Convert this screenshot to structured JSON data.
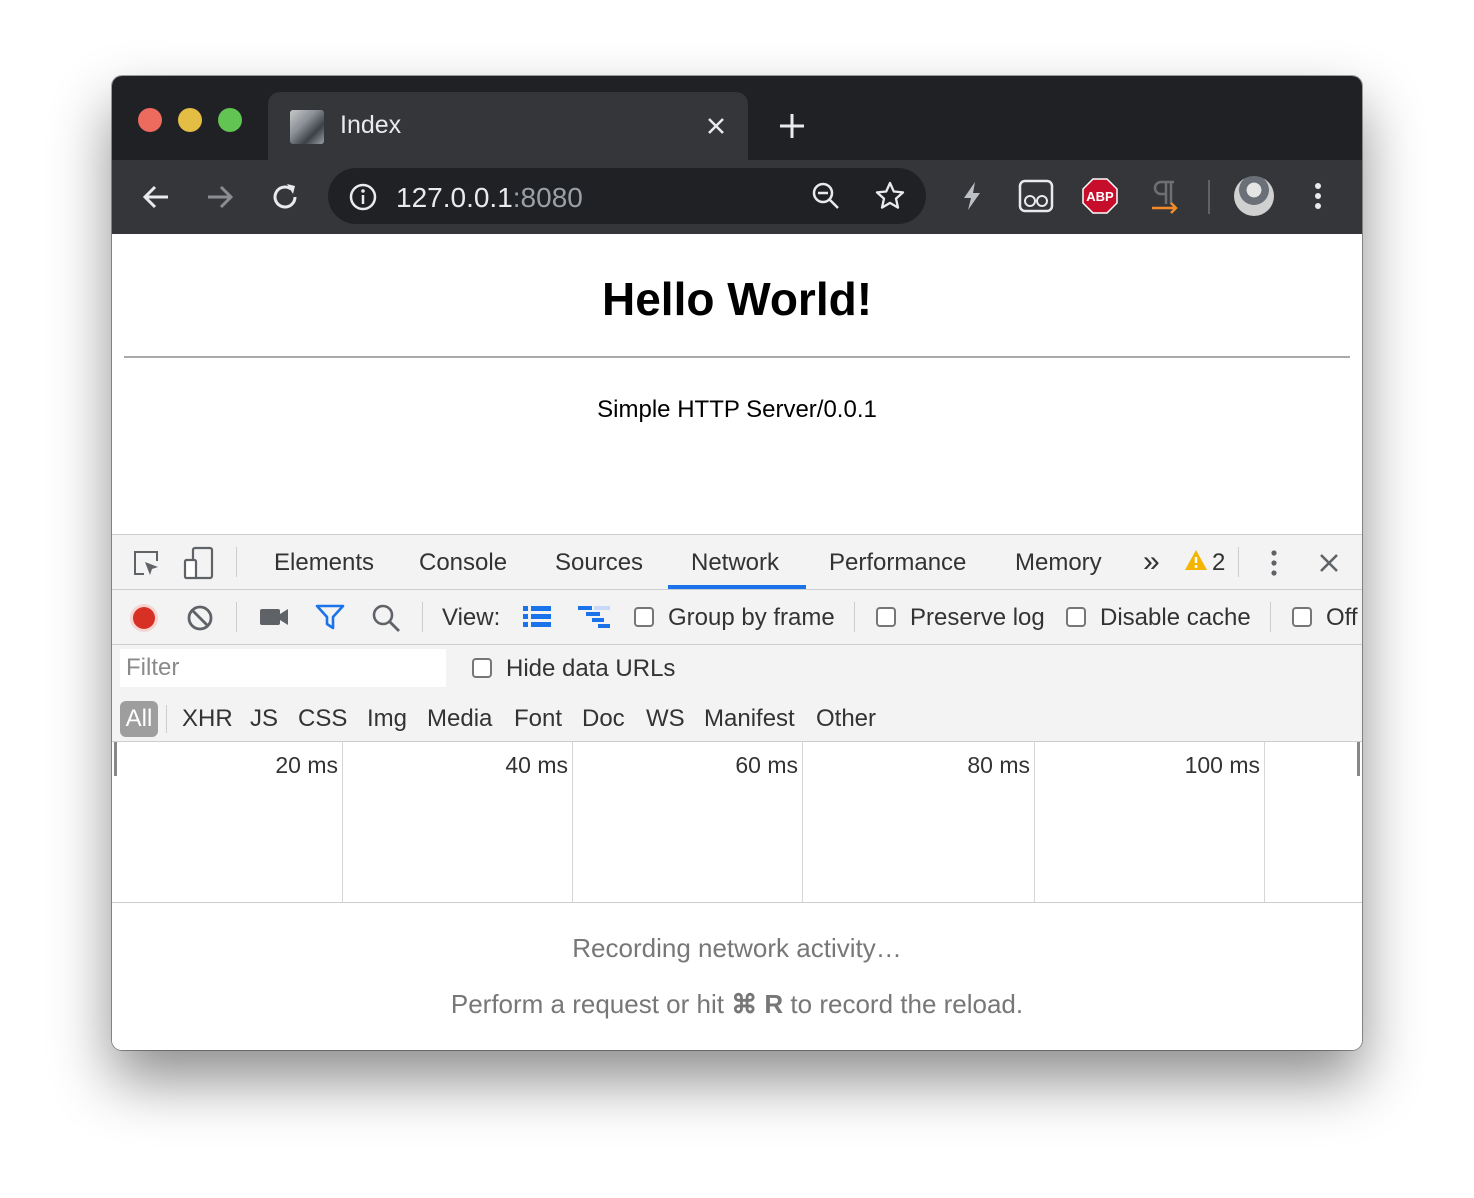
{
  "tab": {
    "title": "Index",
    "close_icon": "close-icon"
  },
  "toolbar": {
    "url_host": "127.0.0.1",
    "url_port": ":8080"
  },
  "page": {
    "heading": "Hello World!",
    "server": "Simple HTTP Server/0.0.1"
  },
  "devtools": {
    "tabs": [
      "Elements",
      "Console",
      "Sources",
      "Network",
      "Performance",
      "Memory"
    ],
    "active_tab": "Network",
    "more_tabs": "»",
    "warning_count": "2",
    "view_label": "View:",
    "group_by_frame": "Group by frame",
    "preserve_log": "Preserve log",
    "disable_cache": "Disable cache",
    "offline": "Off",
    "filter_placeholder": "Filter",
    "hide_data_urls": "Hide data URLs",
    "types": [
      "All",
      "XHR",
      "JS",
      "CSS",
      "Img",
      "Media",
      "Font",
      "Doc",
      "WS",
      "Manifest",
      "Other"
    ],
    "ticks": [
      "20 ms",
      "40 ms",
      "60 ms",
      "80 ms",
      "100 ms"
    ],
    "recording_title": "Recording network activity…",
    "hint_prefix": "Perform a request or hit ",
    "hint_key": "⌘ R",
    "hint_suffix": " to record the reload.",
    "record_color": "#d93025",
    "accent_color": "#1a73e8"
  }
}
